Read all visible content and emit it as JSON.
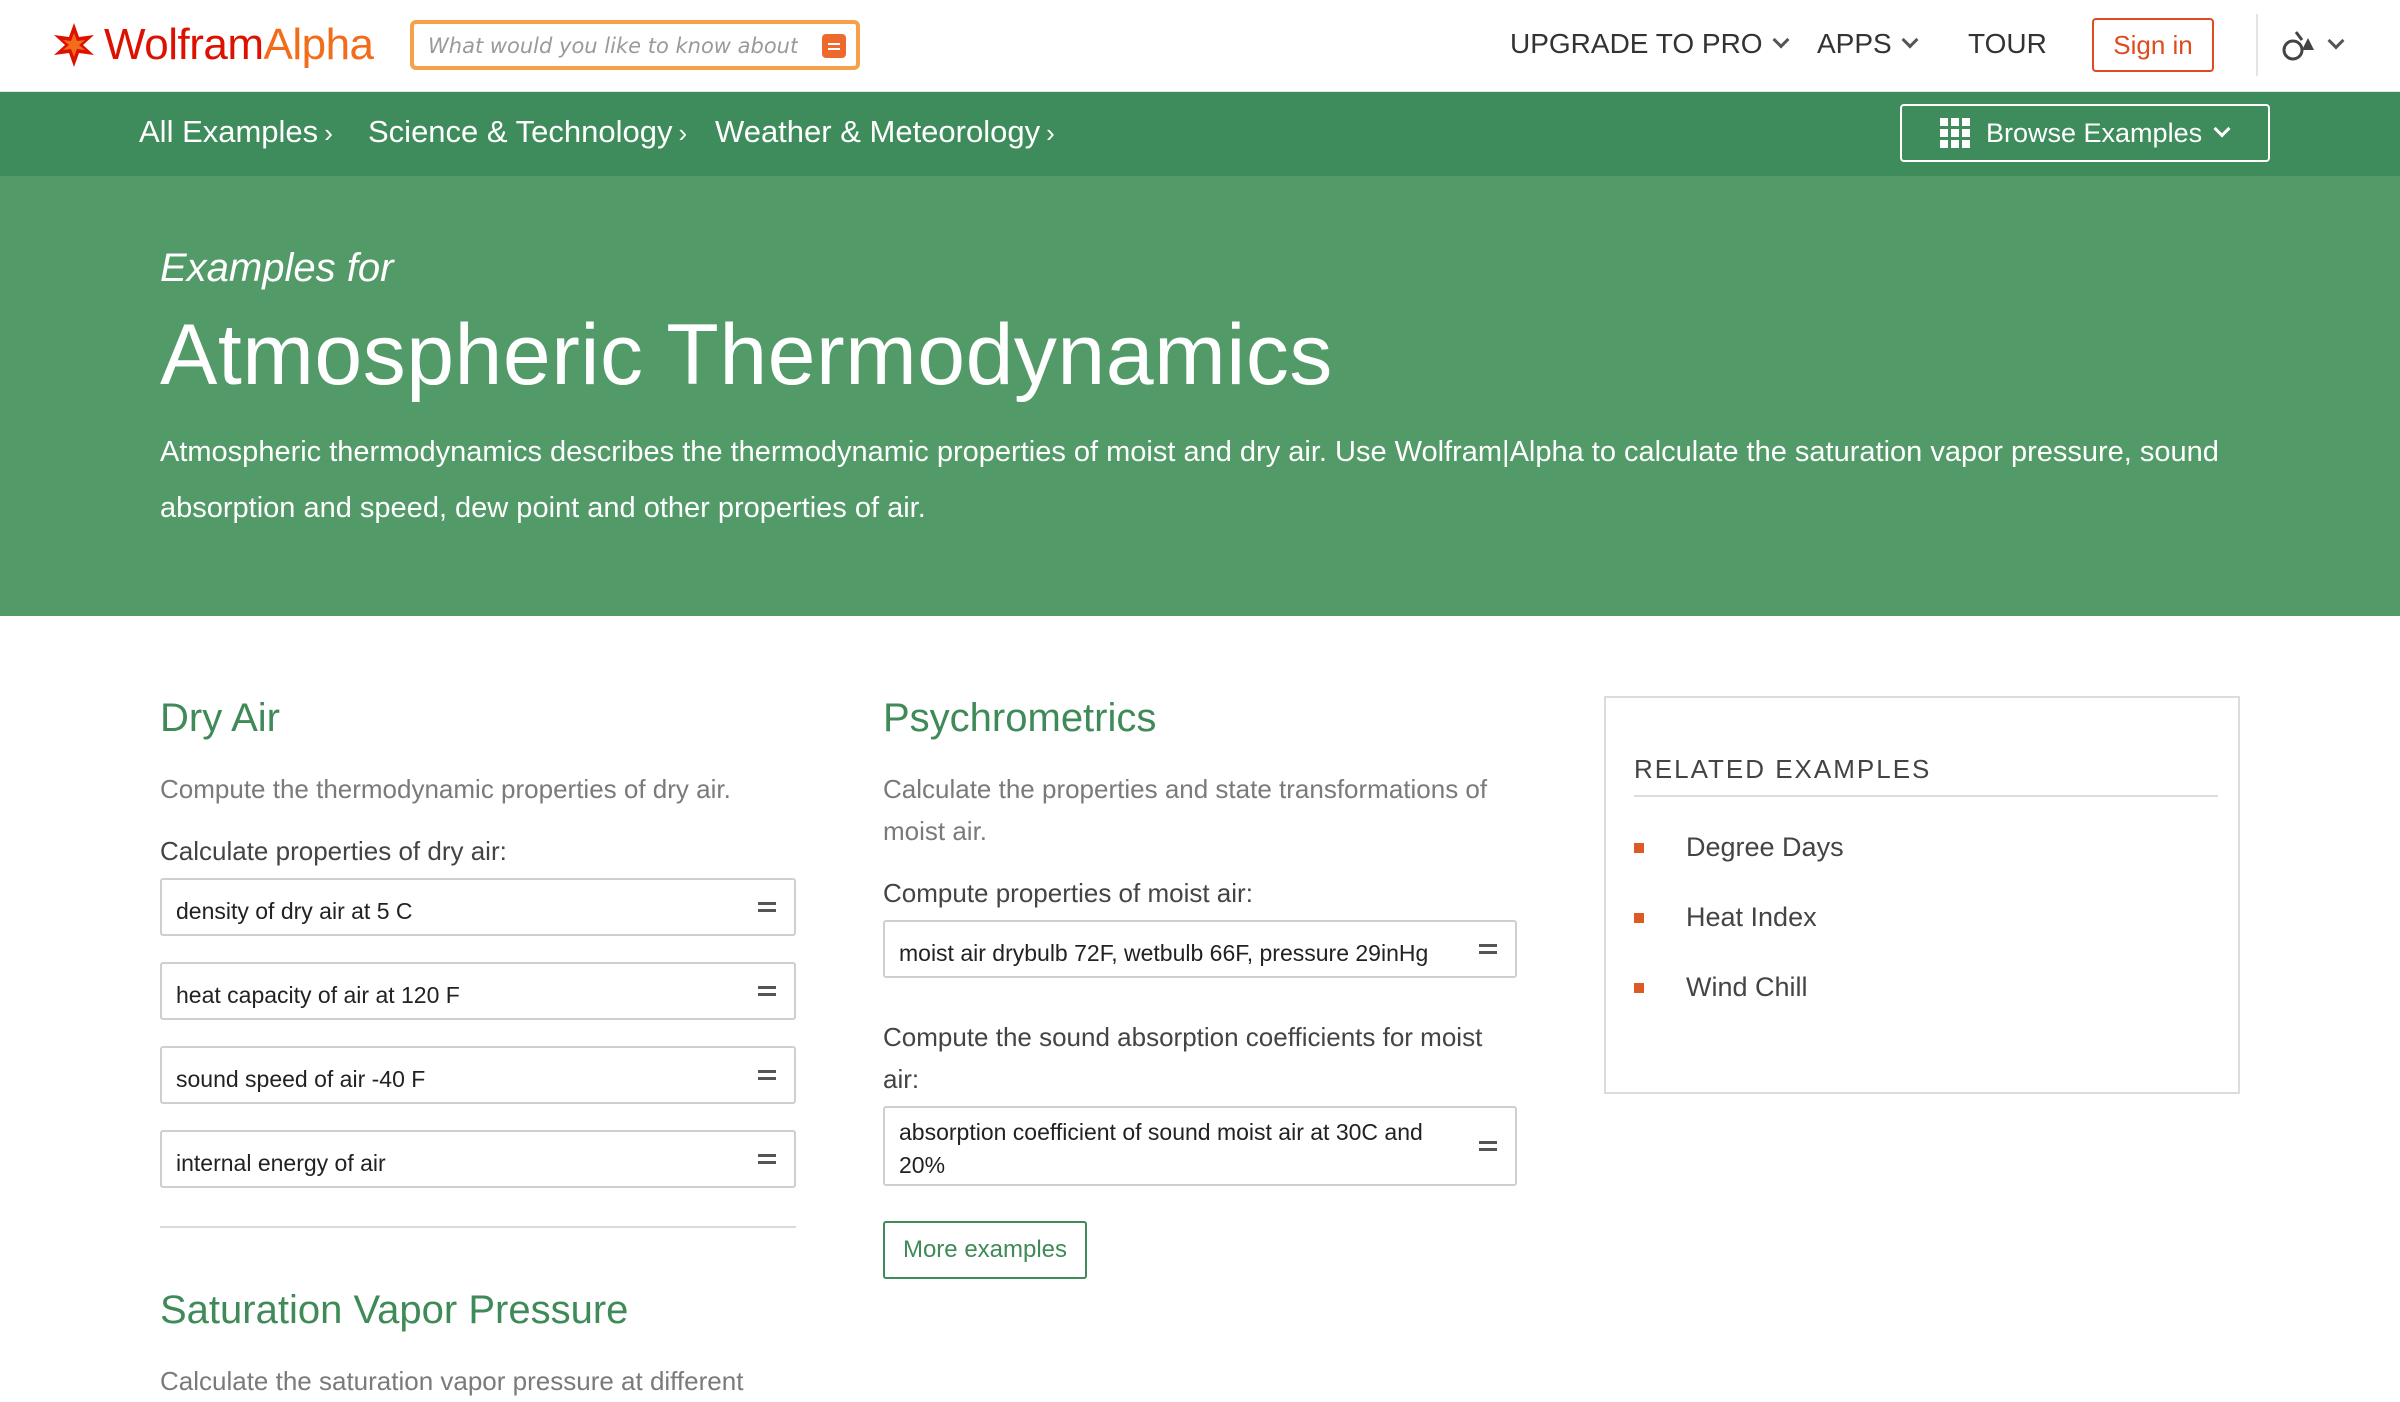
{
  "header": {
    "logo_wolfram": "Wolfram",
    "logo_alpha": "Alpha",
    "search_placeholder": "What would you like to know about?",
    "nav": [
      "UPGRADE TO PRO",
      "APPS",
      "TOUR"
    ],
    "signin_label": "Sign in"
  },
  "breadcrumbs": [
    {
      "label": "All Examples",
      "sep": "›"
    },
    {
      "label": "Science & Technology",
      "sep": "›"
    },
    {
      "label": "Weather & Meteorology",
      "sep": "›"
    }
  ],
  "browse_label": "Browse Examples",
  "hero": {
    "pretitle": "Examples for",
    "title": "Atmospheric Thermodynamics",
    "description": "Atmospheric thermodynamics describes the thermodynamic properties of moist and dry air. Use Wolfram|Alpha to calculate the saturation vapor pressure, sound absorption and speed, dew point and other properties of air."
  },
  "dry_air": {
    "title": "Dry Air",
    "description": "Compute the thermodynamic properties of dry air.",
    "label": "Calculate properties of dry air:",
    "examples": [
      "density of dry air at 5 C",
      "heat capacity of air at 120 F",
      "sound speed of air -40 F",
      "internal energy of air"
    ]
  },
  "saturation": {
    "title": "Saturation Vapor Pressure",
    "description": "Calculate the saturation vapor pressure at different"
  },
  "psychrometrics": {
    "title": "Psychrometrics",
    "description": "Calculate the properties and state transformations of moist air.",
    "label1": "Compute properties of moist air:",
    "example1": "moist air drybulb 72F, wetbulb 66F, pressure 29inHg",
    "label2": "Compute the sound absorption coefficients for moist air:",
    "example2": "absorption coefficient of sound moist air at 30C and 20%",
    "more_label": "More examples"
  },
  "related": {
    "heading": "RELATED EXAMPLES",
    "items": [
      "Degree Days",
      "Heat Index",
      "Wind Chill"
    ]
  },
  "colors": {
    "brand_green_dark": "#3e8c5c",
    "brand_green": "#529a67",
    "accent_orange": "#dd4b1f"
  }
}
